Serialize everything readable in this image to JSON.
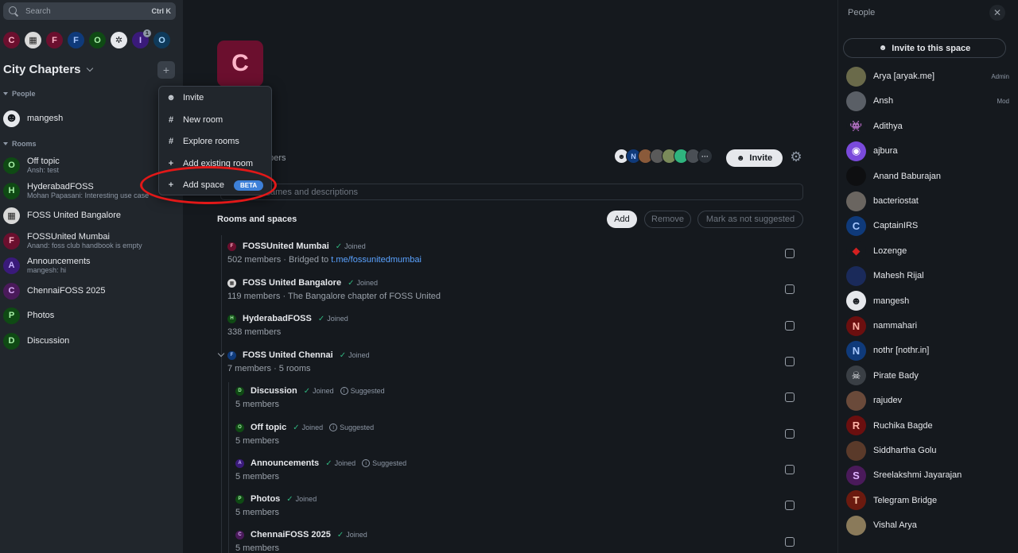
{
  "search": {
    "placeholder": "Search",
    "shortcut": "Ctrl K"
  },
  "space_bar": [
    {
      "letter": "C",
      "bg": "#6b0f2e",
      "fg": "#ffb4c8"
    },
    {
      "letter": "▦",
      "bg": "#d9d9d9",
      "fg": "#222222"
    },
    {
      "letter": "F",
      "bg": "#6b0f2e",
      "fg": "#ffb4c8"
    },
    {
      "letter": "F",
      "bg": "#0f3a7a",
      "fg": "#a8c8ff"
    },
    {
      "letter": "O",
      "bg": "#0f4a14",
      "fg": "#a8f0a8"
    },
    {
      "letter": "✲",
      "bg": "#e6e8ec",
      "fg": "#15191e"
    },
    {
      "letter": "I",
      "bg": "#3a1a7a",
      "fg": "#c8b4ff",
      "count": "1"
    },
    {
      "letter": "O",
      "bg": "#0f3a5a",
      "fg": "#a8d8ff"
    }
  ],
  "space": {
    "name": "City Chapters"
  },
  "sidebar": {
    "people_header": "People",
    "rooms_header": "Rooms",
    "people": [
      {
        "name": "mangesh",
        "avatar": "☻"
      }
    ],
    "rooms": [
      {
        "name": "Off topic",
        "sub": "Ansh: test",
        "letter": "O",
        "bg": "#0f4a14",
        "fg": "#a8f0a8"
      },
      {
        "name": "HyderabadFOSS",
        "sub": "Mohan Papasani: Interesting use case",
        "letter": "H",
        "bg": "#0f4a14",
        "fg": "#a8f0a8"
      },
      {
        "name": "FOSS United Bangalore",
        "sub": "",
        "letter": "▦",
        "bg": "#d9d9d9",
        "fg": "#222222"
      },
      {
        "name": "FOSSUnited Mumbai",
        "sub": "Anand: foss club handbook is empty",
        "letter": "F",
        "bg": "#6b0f2e",
        "fg": "#ffb4c8"
      },
      {
        "name": "Announcements",
        "sub": "mangesh: hi",
        "letter": "A",
        "bg": "#3a1a7a",
        "fg": "#c8b4ff"
      },
      {
        "name": "ChennaiFOSS 2025",
        "sub": "",
        "letter": "C",
        "bg": "#4a1a5a",
        "fg": "#e0b4ff"
      },
      {
        "name": "Photos",
        "sub": "",
        "letter": "P",
        "bg": "#0f4a14",
        "fg": "#a8f0a8"
      },
      {
        "name": "Discussion",
        "sub": "",
        "letter": "D",
        "bg": "#0f4a14",
        "fg": "#a8f0a8"
      }
    ]
  },
  "context_menu": {
    "items": [
      {
        "label": "Invite",
        "icon": "person-add-icon",
        "glyph": "☻"
      },
      {
        "label": "New room",
        "icon": "hash-icon",
        "glyph": "#"
      },
      {
        "label": "Explore rooms",
        "icon": "explore-rooms-icon",
        "glyph": "#"
      },
      {
        "label": "Add existing room",
        "icon": "plus-icon",
        "glyph": "+"
      },
      {
        "label": "Add space",
        "icon": "plus-icon",
        "glyph": "+",
        "badge": "BETA"
      }
    ]
  },
  "main": {
    "avatar_letter": "C",
    "title_visible": "apters",
    "meta_visible": "ce · 19 members",
    "invite_label": "Invite",
    "filter_placeholder": "ames and descriptions",
    "rooms_title": "Rooms and spaces",
    "buttons": {
      "add": "Add",
      "remove": "Remove",
      "mark": "Mark as not suggested"
    },
    "member_avatars": [
      {
        "letter": "☻",
        "bg": "#e6e8ec",
        "fg": "#15191e"
      },
      {
        "letter": "N",
        "bg": "#0f3a7a",
        "fg": "#a8c8ff"
      },
      {
        "letter": "",
        "bg": "#8a5a3a",
        "fg": "#ffffff"
      },
      {
        "letter": "",
        "bg": "#5a5a5a",
        "fg": "#ffffff"
      },
      {
        "letter": "",
        "bg": "#7a8a5a",
        "fg": "#ffffff"
      },
      {
        "letter": "",
        "bg": "#2fb47e",
        "fg": "#ffffff"
      },
      {
        "letter": "",
        "bg": "#4a4f55",
        "fg": "#ffffff"
      },
      {
        "letter": "···",
        "bg": "#2b3138",
        "fg": "#c9ced4"
      }
    ],
    "joined_label": "Joined",
    "suggested_label": "Suggested",
    "entries": [
      {
        "name": "FOSSUnited Mumbai",
        "letter": "F",
        "bg": "#6b0f2e",
        "fg": "#ffb4c8",
        "joined": true,
        "suggested": false,
        "meta": "502 members · Bridged to ",
        "link": "t.me/fossunitedmumbai",
        "indent": 0
      },
      {
        "name": "FOSS United Bangalore",
        "letter": "▦",
        "bg": "#d9d9d9",
        "fg": "#222222",
        "joined": true,
        "suggested": false,
        "meta": "119 members · The Bangalore chapter of FOSS United",
        "link": "",
        "indent": 0
      },
      {
        "name": "HyderabadFOSS",
        "letter": "H",
        "bg": "#0f4a14",
        "fg": "#a8f0a8",
        "joined": true,
        "suggested": false,
        "meta": "338 members",
        "link": "",
        "indent": 0
      },
      {
        "name": "FOSS United Chennai",
        "letter": "F",
        "bg": "#0f3a7a",
        "fg": "#a8c8ff",
        "joined": true,
        "suggested": false,
        "meta": "7 members · 5 rooms",
        "link": "",
        "indent": 0,
        "expanded": true
      },
      {
        "name": "Discussion",
        "letter": "D",
        "bg": "#0f4a14",
        "fg": "#a8f0a8",
        "joined": true,
        "suggested": true,
        "meta": "5 members",
        "link": "",
        "indent": 1
      },
      {
        "name": "Off topic",
        "letter": "O",
        "bg": "#0f4a14",
        "fg": "#a8f0a8",
        "joined": true,
        "suggested": true,
        "meta": "5 members",
        "link": "",
        "indent": 1
      },
      {
        "name": "Announcements",
        "letter": "A",
        "bg": "#3a1a7a",
        "fg": "#c8b4ff",
        "joined": true,
        "suggested": true,
        "meta": "5 members",
        "link": "",
        "indent": 1
      },
      {
        "name": "Photos",
        "letter": "P",
        "bg": "#0f4a14",
        "fg": "#a8f0a8",
        "joined": true,
        "suggested": false,
        "meta": "5 members",
        "link": "",
        "indent": 1
      },
      {
        "name": "ChennaiFOSS 2025",
        "letter": "C",
        "bg": "#4a1a5a",
        "fg": "#e0b4ff",
        "joined": true,
        "suggested": false,
        "meta": "5 members",
        "link": "",
        "indent": 1
      }
    ]
  },
  "right_panel": {
    "title": "People",
    "invite_label": "Invite to this space",
    "people": [
      {
        "name": "Arya [aryak.me]",
        "role": "Admin",
        "letter": "",
        "bg": "#6a6a4a",
        "fg": "#ffffff"
      },
      {
        "name": "Ansh",
        "role": "Mod",
        "letter": "",
        "bg": "#5a5f66",
        "fg": "#ffffff"
      },
      {
        "name": "Adithya",
        "role": "",
        "letter": "👾",
        "bg": "#15191e",
        "fg": "#2fd47e"
      },
      {
        "name": "ajbura",
        "role": "",
        "letter": "◉",
        "bg": "#7a4adb",
        "fg": "#ffffff"
      },
      {
        "name": "Anand Baburajan",
        "role": "",
        "letter": "",
        "bg": "#0e0f11",
        "fg": "#ffffff"
      },
      {
        "name": "bacteriostat",
        "role": "",
        "letter": "",
        "bg": "#6a6560",
        "fg": "#ffffff"
      },
      {
        "name": "CaptainIRS",
        "role": "",
        "letter": "C",
        "bg": "#0f3a7a",
        "fg": "#a8c8ff"
      },
      {
        "name": "Lozenge",
        "role": "",
        "letter": "◆",
        "bg": "#15191e",
        "fg": "#d42020"
      },
      {
        "name": "Mahesh Rijal",
        "role": "",
        "letter": "",
        "bg": "#1a2a5a",
        "fg": "#ffffff"
      },
      {
        "name": "mangesh",
        "role": "",
        "letter": "☻",
        "bg": "#e6e8ec",
        "fg": "#15191e"
      },
      {
        "name": "nammahari",
        "role": "",
        "letter": "N",
        "bg": "#6b0f0f",
        "fg": "#ffb4a8"
      },
      {
        "name": "nothr [nothr.in]",
        "role": "",
        "letter": "N",
        "bg": "#0f3a7a",
        "fg": "#a8c8ff"
      },
      {
        "name": "Pirate Bady",
        "role": "",
        "letter": "☠",
        "bg": "#3a3f45",
        "fg": "#e6e8ec"
      },
      {
        "name": "rajudev",
        "role": "",
        "letter": "",
        "bg": "#6a4a3a",
        "fg": "#ffffff"
      },
      {
        "name": "Ruchika Bagde",
        "role": "",
        "letter": "R",
        "bg": "#6b0f0f",
        "fg": "#ffb4a8"
      },
      {
        "name": "Siddhartha Golu",
        "role": "",
        "letter": "",
        "bg": "#5a3a2a",
        "fg": "#ffffff"
      },
      {
        "name": "Sreelakshmi Jayarajan",
        "role": "",
        "letter": "S",
        "bg": "#4a1a5a",
        "fg": "#e0b4ff"
      },
      {
        "name": "Telegram Bridge",
        "role": "",
        "letter": "T",
        "bg": "#6b1a0f",
        "fg": "#ffc8a8"
      },
      {
        "name": "Vishal Arya",
        "role": "",
        "letter": "",
        "bg": "#8a7a5a",
        "fg": "#ffffff"
      }
    ]
  }
}
